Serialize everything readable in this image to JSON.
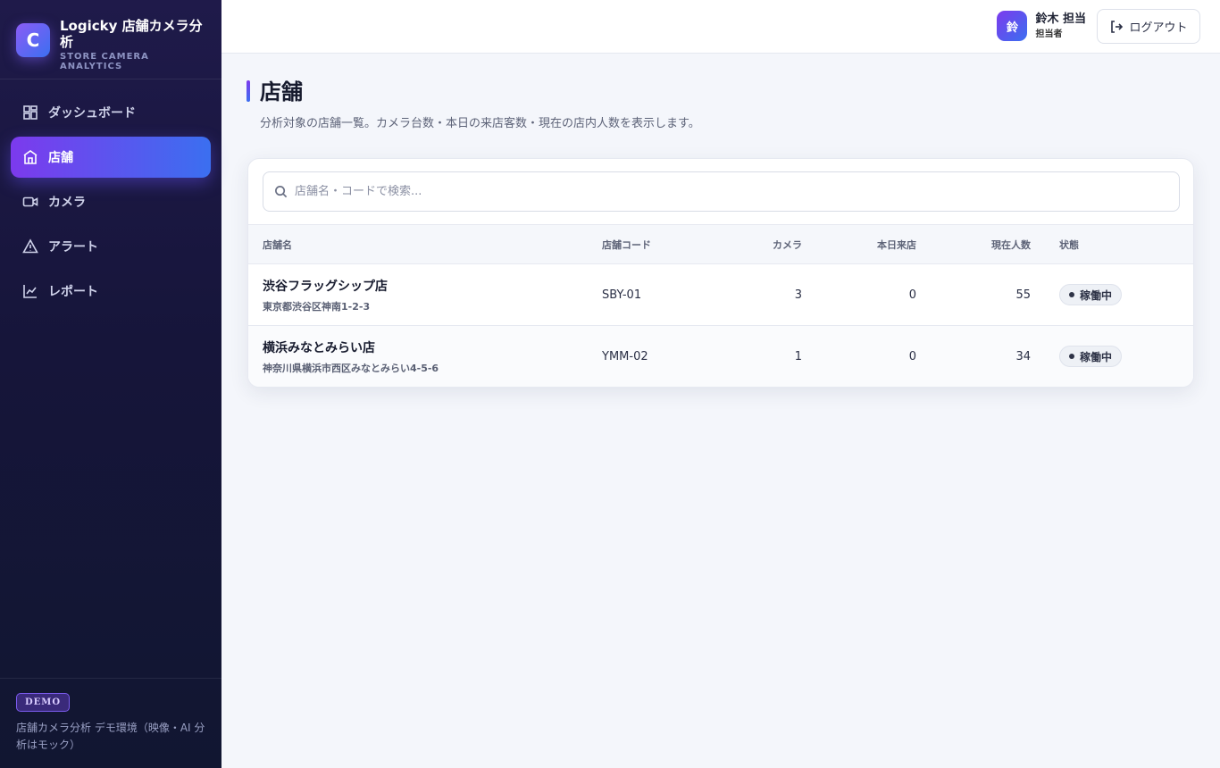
{
  "brand": {
    "logo_letter": "C",
    "title": "Logicky 店舗カメラ分析",
    "subtitle": "STORE CAMERA ANALYTICS"
  },
  "sidebar": {
    "items": [
      {
        "label": "ダッシュボード",
        "icon": "dashboard-icon",
        "active": false
      },
      {
        "label": "店舗",
        "icon": "store-icon",
        "active": true
      },
      {
        "label": "カメラ",
        "icon": "camera-icon",
        "active": false
      },
      {
        "label": "アラート",
        "icon": "alert-icon",
        "active": false
      },
      {
        "label": "レポート",
        "icon": "report-icon",
        "active": false
      }
    ],
    "footer": {
      "badge": "DEMO",
      "text": "店舗カメラ分析 デモ環境（映像・AI 分析はモック）"
    }
  },
  "header": {
    "avatar_text": "鈴",
    "user_name": "鈴木 担当",
    "user_role": "担当者",
    "logout_label": "ログアウト"
  },
  "page": {
    "title": "店舗",
    "description": "分析対象の店舗一覧。カメラ台数・本日の来店客数・現在の店内人数を表示します。"
  },
  "search": {
    "placeholder": "店舗名・コードで検索...",
    "value": ""
  },
  "table": {
    "columns": [
      "店舗名",
      "店舗コード",
      "カメラ",
      "本日来店",
      "現在人数",
      "状態"
    ],
    "rows": [
      {
        "name": "渋谷フラッグシップ店",
        "address": "東京都渋谷区神南1-2-3",
        "code": "SBY-01",
        "cameras": "3",
        "visitors_today": "0",
        "current_count": "55",
        "status": "稼働中"
      },
      {
        "name": "横浜みなとみらい店",
        "address": "神奈川県横浜市西区みなとみらい4-5-6",
        "code": "YMM-02",
        "cameras": "1",
        "visitors_today": "0",
        "current_count": "34",
        "status": "稼働中"
      }
    ]
  },
  "colors": {
    "accent_start": "#7c3aed",
    "accent_end": "#3b6ff0",
    "sidebar_bg": "#1f1a4a"
  }
}
